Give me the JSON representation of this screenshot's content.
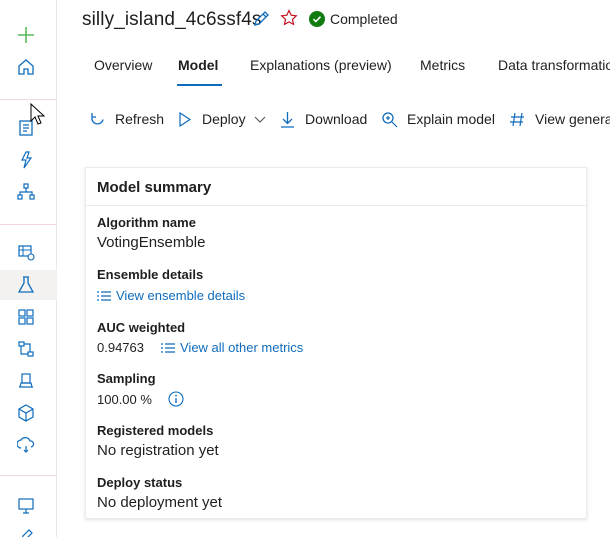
{
  "app": {
    "run_title": "silly_island_4c6ssf4s",
    "status": "Completed",
    "colors": {
      "accent": "#0f6cbd",
      "success": "#107c10",
      "star": "#c50f1f"
    }
  },
  "rail": {
    "icons": [
      "plus-icon",
      "home-icon",
      "notebook-icon",
      "automl-icon",
      "designer-icon",
      "datasets-icon",
      "experiments-icon",
      "pipelines-icon",
      "models-icon",
      "endpoints-icon",
      "compute-icon",
      "environments-icon",
      "datastores-icon",
      "workspace-icon",
      "pen-icon"
    ]
  },
  "tabs": [
    {
      "label": "Overview"
    },
    {
      "label": "Model"
    },
    {
      "label": "Explanations (preview)"
    },
    {
      "label": "Metrics"
    },
    {
      "label": "Data transformatio"
    }
  ],
  "toolbar": {
    "refresh": "Refresh",
    "deploy": "Deploy",
    "download": "Download",
    "explain": "Explain model",
    "view_generated": "View genera"
  },
  "summary": {
    "title": "Model summary",
    "algorithm_label": "Algorithm name",
    "algorithm_value": "VotingEnsemble",
    "ensemble_label": "Ensemble details",
    "ensemble_link": "View ensemble details",
    "auc_label": "AUC weighted",
    "auc_value": "0.94763",
    "metrics_link": "View all other metrics",
    "sampling_label": "Sampling",
    "sampling_value": "100.00 %",
    "registered_label": "Registered models",
    "registered_value": "No registration yet",
    "deploy_label": "Deploy status",
    "deploy_value": "No deployment yet"
  }
}
